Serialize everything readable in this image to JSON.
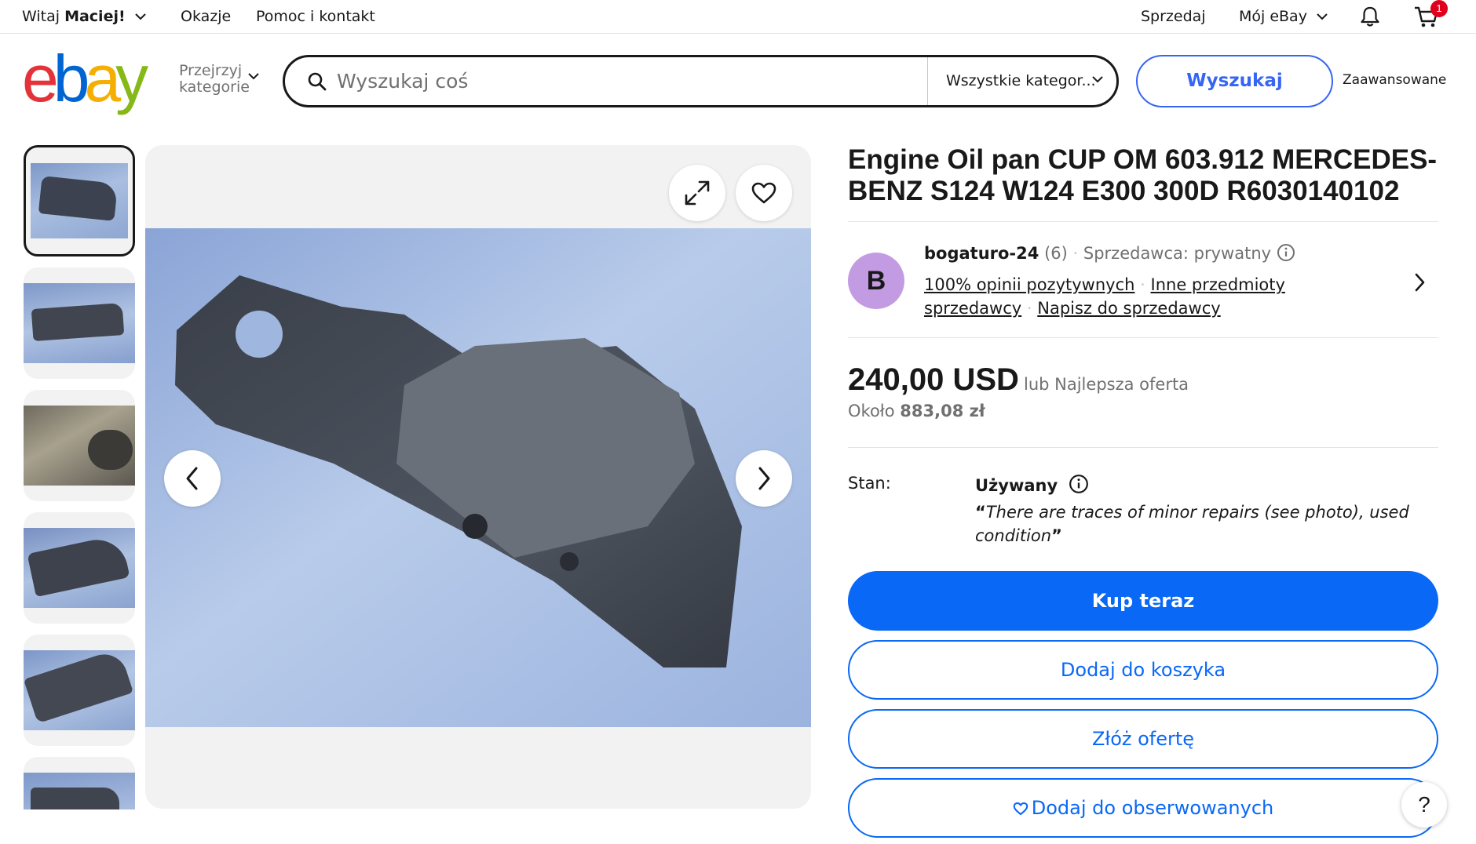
{
  "topbar": {
    "greeting_prefix": "Witaj ",
    "greeting_name": "Maciej!",
    "deals": "Okazje",
    "help_contact": "Pomoc i kontakt",
    "sell": "Sprzedaj",
    "my_ebay": "Mój eBay",
    "cart_count": "1",
    "icons": [
      "bell-icon",
      "cart-icon",
      "chevron-down-icon"
    ]
  },
  "header": {
    "logo_letters": [
      "e",
      "b",
      "a",
      "y"
    ],
    "logo_colors": [
      "#e53238",
      "#0064d2",
      "#f5af02",
      "#86b817"
    ],
    "browse_line1": "Przejrzyj",
    "browse_line2": "kategorie",
    "search_placeholder": "Wyszukaj coś",
    "category": "Wszystkie kategor...",
    "search_button": "Wyszukaj",
    "advanced": "Zaawansowane"
  },
  "gallery": {
    "thumbnail_count": 6,
    "selected_index": 0,
    "icons": [
      "expand-icon",
      "heart-icon",
      "chevron-left-icon",
      "chevron-right-icon"
    ]
  },
  "listing": {
    "title": "Engine Oil pan CUP OM 603.912 MERCEDES-BENZ S124 W124 E300 300D R6030140102",
    "seller": {
      "avatar_letter": "B",
      "name": "bogaturo-24",
      "feedback_count": "(6)",
      "type": "Sprzedawca: prywatny",
      "positive": "100% opinii pozytywnych",
      "other_items": "Inne przedmioty sprzedawcy",
      "contact": "Napisz do sprzedawcy"
    },
    "price": "240,00 USD",
    "price_alt": "lub Najlepsza oferta",
    "approx_prefix": "Około ",
    "approx_value": "883,08 zł",
    "condition_label": "Stan:",
    "condition_value": "Używany",
    "condition_desc": "There are traces of minor repairs (see photo), used condition",
    "buy_now": "Kup teraz",
    "add_to_cart": "Dodaj do koszyka",
    "make_offer": "Złóż ofertę",
    "watch": "Dodaj do obserwowanych"
  },
  "help_button": "?"
}
